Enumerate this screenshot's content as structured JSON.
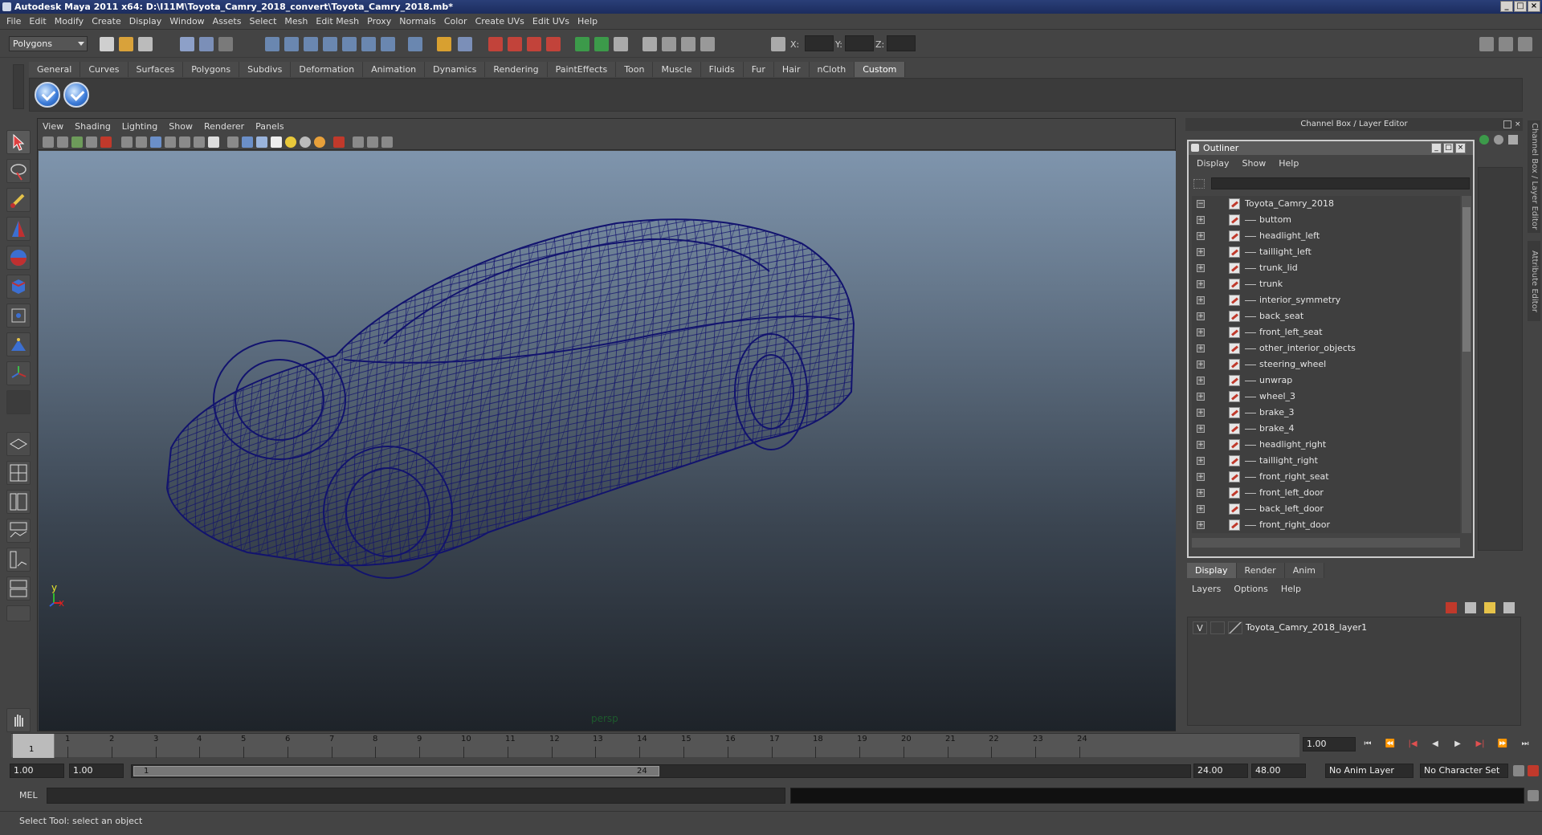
{
  "window": {
    "title": "Autodesk Maya 2011 x64: D:\\I11M\\Toyota_Camry_2018_convert\\Toyota_Camry_2018.mb*"
  },
  "menubar": [
    "File",
    "Edit",
    "Modify",
    "Create",
    "Display",
    "Window",
    "Assets",
    "Select",
    "Mesh",
    "Edit Mesh",
    "Proxy",
    "Normals",
    "Color",
    "Create UVs",
    "Edit UVs",
    "Help"
  ],
  "statusline": {
    "mode": "Polygons",
    "x_label": "X:",
    "y_label": "Y:",
    "z_label": "Z:"
  },
  "shelf": {
    "tabs": [
      "General",
      "Curves",
      "Surfaces",
      "Polygons",
      "Subdivs",
      "Deformation",
      "Animation",
      "Dynamics",
      "Rendering",
      "PaintEffects",
      "Toon",
      "Muscle",
      "Fluids",
      "Fur",
      "Hair",
      "nCloth",
      "Custom"
    ],
    "active_tab": "Custom"
  },
  "viewport": {
    "menu": [
      "View",
      "Shading",
      "Lighting",
      "Show",
      "Renderer",
      "Panels"
    ],
    "camera": "persp",
    "axis_y": "y",
    "axis_x": "x",
    "wireframe_color": "#12136e"
  },
  "right_panel": {
    "header": "Channel Box / Layer Editor",
    "side_tabs": [
      "Channel Box / Layer Editor",
      "Attribute Editor"
    ]
  },
  "outliner": {
    "title": "Outliner",
    "menu": [
      "Display",
      "Show",
      "Help"
    ],
    "root": "Toyota_Camry_2018",
    "items": [
      "buttom",
      "headlight_left",
      "taillight_left",
      "trunk_lid",
      "trunk",
      "interior_symmetry",
      "back_seat",
      "front_left_seat",
      "other_interior_objects",
      "steering_wheel",
      "unwrap",
      "wheel_3",
      "brake_3",
      "brake_4",
      "headlight_right",
      "taillight_right",
      "front_right_seat",
      "front_left_door",
      "back_left_door",
      "front_right_door"
    ]
  },
  "layer_editor": {
    "tabs": [
      "Display",
      "Render",
      "Anim"
    ],
    "active_tab": "Display",
    "menu": [
      "Layers",
      "Options",
      "Help"
    ],
    "layer": {
      "visible": "V",
      "name": "Toyota_Camry_2018_layer1"
    }
  },
  "timeline": {
    "ticks": [
      "1",
      "2",
      "3",
      "4",
      "5",
      "6",
      "7",
      "8",
      "9",
      "10",
      "11",
      "12",
      "13",
      "14",
      "15",
      "16",
      "17",
      "18",
      "19",
      "20",
      "21",
      "22",
      "23",
      "24"
    ],
    "current_frame": "1",
    "current_time_field": "1.00"
  },
  "range": {
    "start": "1.00",
    "anim_start": "1.00",
    "range_start_label": "1",
    "range_end_label": "24",
    "anim_end": "24.00",
    "end": "48.00",
    "anim_layer": "No Anim Layer",
    "character_set": "No Character Set"
  },
  "command_line": {
    "label": "MEL"
  },
  "help_line": {
    "text": "Select Tool: select an object"
  }
}
